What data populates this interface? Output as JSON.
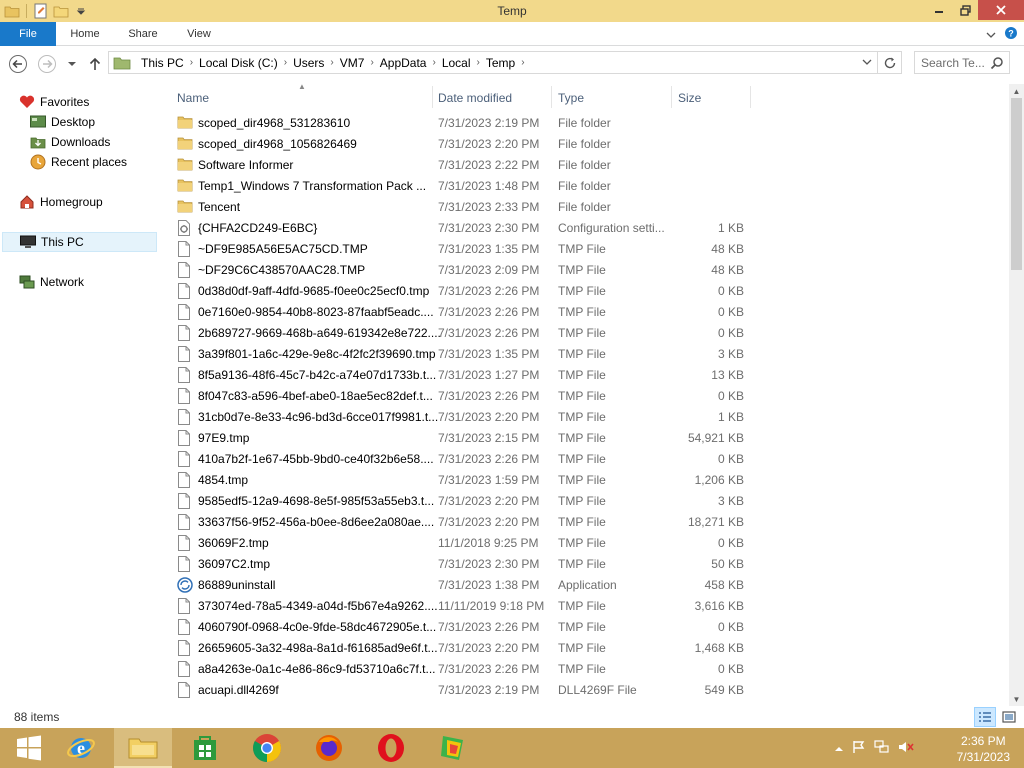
{
  "window": {
    "title": "Temp",
    "ribbon_tabs": [
      "File",
      "Home",
      "Share",
      "View"
    ]
  },
  "nav": {
    "breadcrumb": [
      "This PC",
      "Local Disk (C:)",
      "Users",
      "VM7",
      "AppData",
      "Local",
      "Temp"
    ],
    "search_placeholder": "Search Te..."
  },
  "sidebar": {
    "favorites": "Favorites",
    "desktop": "Desktop",
    "downloads": "Downloads",
    "recent": "Recent places",
    "homegroup": "Homegroup",
    "thispc": "This PC",
    "network": "Network"
  },
  "columns": {
    "name": "Name",
    "date": "Date modified",
    "type": "Type",
    "size": "Size"
  },
  "files": [
    {
      "icon": "folder",
      "name": "scoped_dir4968_531283610",
      "date": "7/31/2023 2:19 PM",
      "type": "File folder",
      "size": ""
    },
    {
      "icon": "folder",
      "name": "scoped_dir4968_1056826469",
      "date": "7/31/2023 2:20 PM",
      "type": "File folder",
      "size": ""
    },
    {
      "icon": "folder",
      "name": "Software Informer",
      "date": "7/31/2023 2:22 PM",
      "type": "File folder",
      "size": ""
    },
    {
      "icon": "folder",
      "name": "Temp1_Windows 7 Transformation Pack ...",
      "date": "7/31/2023 1:48 PM",
      "type": "File folder",
      "size": ""
    },
    {
      "icon": "folder",
      "name": "Tencent",
      "date": "7/31/2023 2:33 PM",
      "type": "File folder",
      "size": ""
    },
    {
      "icon": "config",
      "name": "{CHFA2CD249-E6BC}",
      "date": "7/31/2023 2:30 PM",
      "type": "Configuration setti...",
      "size": "1 KB"
    },
    {
      "icon": "file",
      "name": "~DF9E985A56E5AC75CD.TMP",
      "date": "7/31/2023 1:35 PM",
      "type": "TMP File",
      "size": "48 KB"
    },
    {
      "icon": "file",
      "name": "~DF29C6C438570AAC28.TMP",
      "date": "7/31/2023 2:09 PM",
      "type": "TMP File",
      "size": "48 KB"
    },
    {
      "icon": "file",
      "name": "0d38d0df-9aff-4dfd-9685-f0ee0c25ecf0.tmp",
      "date": "7/31/2023 2:26 PM",
      "type": "TMP File",
      "size": "0 KB"
    },
    {
      "icon": "file",
      "name": "0e7160e0-9854-40b8-8023-87faabf5eadc....",
      "date": "7/31/2023 2:26 PM",
      "type": "TMP File",
      "size": "0 KB"
    },
    {
      "icon": "file",
      "name": "2b689727-9669-468b-a649-619342e8e722....",
      "date": "7/31/2023 2:26 PM",
      "type": "TMP File",
      "size": "0 KB"
    },
    {
      "icon": "file",
      "name": "3a39f801-1a6c-429e-9e8c-4f2fc2f39690.tmp",
      "date": "7/31/2023 1:35 PM",
      "type": "TMP File",
      "size": "3 KB"
    },
    {
      "icon": "file",
      "name": "8f5a9136-48f6-45c7-b42c-a74e07d1733b.t...",
      "date": "7/31/2023 1:27 PM",
      "type": "TMP File",
      "size": "13 KB"
    },
    {
      "icon": "file",
      "name": "8f047c83-a596-4bef-abe0-18ae5ec82def.t...",
      "date": "7/31/2023 2:26 PM",
      "type": "TMP File",
      "size": "0 KB"
    },
    {
      "icon": "file",
      "name": "31cb0d7e-8e33-4c96-bd3d-6cce017f9981.t...",
      "date": "7/31/2023 2:20 PM",
      "type": "TMP File",
      "size": "1 KB"
    },
    {
      "icon": "file",
      "name": "97E9.tmp",
      "date": "7/31/2023 2:15 PM",
      "type": "TMP File",
      "size": "54,921 KB"
    },
    {
      "icon": "file",
      "name": "410a7b2f-1e67-45bb-9bd0-ce40f32b6e58....",
      "date": "7/31/2023 2:26 PM",
      "type": "TMP File",
      "size": "0 KB"
    },
    {
      "icon": "file",
      "name": "4854.tmp",
      "date": "7/31/2023 1:59 PM",
      "type": "TMP File",
      "size": "1,206 KB"
    },
    {
      "icon": "file",
      "name": "9585edf5-12a9-4698-8e5f-985f53a55eb3.t...",
      "date": "7/31/2023 2:20 PM",
      "type": "TMP File",
      "size": "3 KB"
    },
    {
      "icon": "file",
      "name": "33637f56-9f52-456a-b0ee-8d6ee2a080ae....",
      "date": "7/31/2023 2:20 PM",
      "type": "TMP File",
      "size": "18,271 KB"
    },
    {
      "icon": "file",
      "name": "36069F2.tmp",
      "date": "11/1/2018 9:25 PM",
      "type": "TMP File",
      "size": "0 KB"
    },
    {
      "icon": "file",
      "name": "36097C2.tmp",
      "date": "7/31/2023 2:30 PM",
      "type": "TMP File",
      "size": "50 KB"
    },
    {
      "icon": "app",
      "name": "86889uninstall",
      "date": "7/31/2023 1:38 PM",
      "type": "Application",
      "size": "458 KB"
    },
    {
      "icon": "file",
      "name": "373074ed-78a5-4349-a04d-f5b67e4a9262....",
      "date": "11/11/2019 9:18 PM",
      "type": "TMP File",
      "size": "3,616 KB"
    },
    {
      "icon": "file",
      "name": "4060790f-0968-4c0e-9fde-58dc4672905e.t...",
      "date": "7/31/2023 2:26 PM",
      "type": "TMP File",
      "size": "0 KB"
    },
    {
      "icon": "file",
      "name": "26659605-3a32-498a-8a1d-f61685ad9e6f.t...",
      "date": "7/31/2023 2:20 PM",
      "type": "TMP File",
      "size": "1,468 KB"
    },
    {
      "icon": "file",
      "name": "a8a4263e-0a1c-4e86-86c9-fd53710a6c7f.t...",
      "date": "7/31/2023 2:26 PM",
      "type": "TMP File",
      "size": "0 KB"
    },
    {
      "icon": "file",
      "name": "acuapi.dll4269f",
      "date": "7/31/2023 2:19 PM",
      "type": "DLL4269F File",
      "size": "549 KB"
    }
  ],
  "status": {
    "item_count": "88 items"
  },
  "taskbar": {
    "apps": [
      "start-icon",
      "internet-explorer-icon",
      "file-explorer-icon",
      "store-icon",
      "chrome-icon",
      "firefox-icon",
      "opera-icon",
      "bluestacks-icon"
    ],
    "time": "2:36 PM",
    "date": "7/31/2023"
  },
  "colors": {
    "titlebar": "#f2d98b",
    "file_tab": "#1979ca",
    "close_button": "#c7504a",
    "taskbar": "#c8a35a",
    "folder": "#e8c360"
  }
}
